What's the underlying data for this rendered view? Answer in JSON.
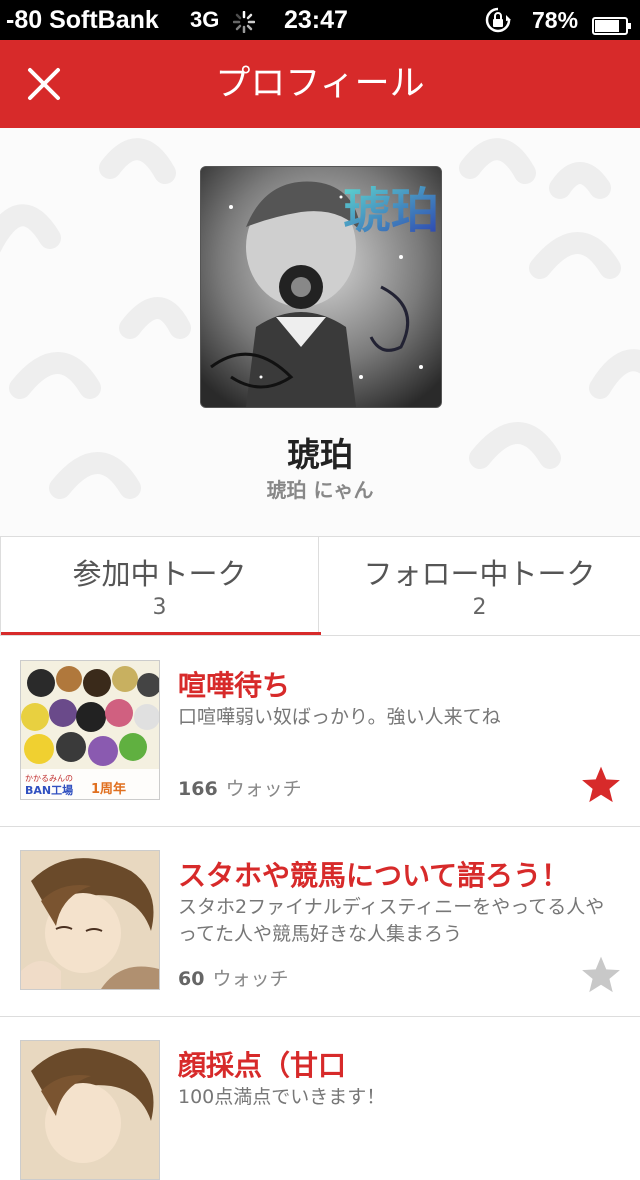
{
  "status_bar": {
    "carrier": "-80 SoftBank",
    "network": "3G",
    "time": "23:47",
    "battery": "78%"
  },
  "nav": {
    "title": "プロフィール",
    "close_icon": "close-icon"
  },
  "profile": {
    "avatar_text": "琥珀",
    "name": "琥珀",
    "subtitle": "琥珀 にゃん"
  },
  "tabs": [
    {
      "label": "参加中トーク",
      "count": "3",
      "active": true
    },
    {
      "label": "フォロー中トーク",
      "count": "2",
      "active": false
    }
  ],
  "talks": [
    {
      "title": "喧嘩待ち",
      "description": "口喧嘩弱い奴ばっかり。強い人来てね",
      "watch_count": "166",
      "watch_label": "ウォッチ",
      "starred": true,
      "thumb_text_1": "かかるみんの",
      "thumb_text_2": "BAN工場",
      "thumb_text_3": "1周年"
    },
    {
      "title": "スタホや競馬について語ろう！",
      "description": "スタホ2ファイナルディスティニーをやってる人やってた人や競馬好きな人集まろう",
      "watch_count": "60",
      "watch_label": "ウォッチ",
      "starred": false
    },
    {
      "title": "顔採点（甘口",
      "description": "100点満点でいきます！",
      "starred": false
    }
  ],
  "colors": {
    "accent": "#d72a2a",
    "star_active": "#d72a2a",
    "star_inactive": "#c8c8c8"
  }
}
